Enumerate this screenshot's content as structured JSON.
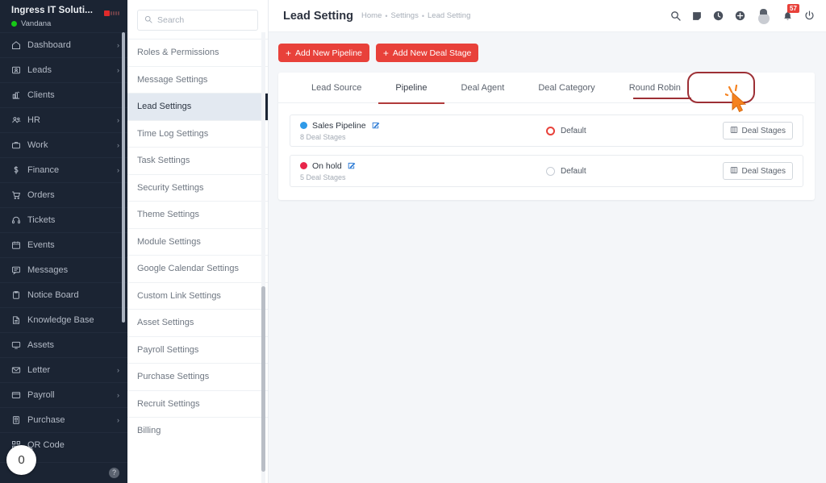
{
  "sidebar": {
    "company": "Ingress IT Soluti...",
    "user": "Vandana",
    "status_color": "#16c916",
    "items": [
      {
        "label": "Dashboard",
        "icon": "home-icon",
        "chevron": "›"
      },
      {
        "label": "Leads",
        "icon": "leads-icon",
        "chevron": "›"
      },
      {
        "label": "Clients",
        "icon": "clients-icon",
        "chevron": ""
      },
      {
        "label": "HR",
        "icon": "hr-icon",
        "chevron": "›"
      },
      {
        "label": "Work",
        "icon": "work-icon",
        "chevron": "›"
      },
      {
        "label": "Finance",
        "icon": "finance-icon",
        "chevron": "›"
      },
      {
        "label": "Orders",
        "icon": "orders-icon",
        "chevron": ""
      },
      {
        "label": "Tickets",
        "icon": "tickets-icon",
        "chevron": ""
      },
      {
        "label": "Events",
        "icon": "events-icon",
        "chevron": ""
      },
      {
        "label": "Messages",
        "icon": "messages-icon",
        "chevron": ""
      },
      {
        "label": "Notice Board",
        "icon": "notice-board-icon",
        "chevron": ""
      },
      {
        "label": "Knowledge Base",
        "icon": "knowledge-base-icon",
        "chevron": ""
      },
      {
        "label": "Assets",
        "icon": "assets-icon",
        "chevron": ""
      },
      {
        "label": "Letter",
        "icon": "letter-icon",
        "chevron": "›"
      },
      {
        "label": "Payroll",
        "icon": "payroll-icon",
        "chevron": "›"
      },
      {
        "label": "Purchase",
        "icon": "purchase-icon",
        "chevron": "›"
      },
      {
        "label": "QR Code",
        "icon": "qr-code-icon",
        "chevron": ""
      }
    ],
    "help_label": "?",
    "counter_bubble": "0"
  },
  "subnav": {
    "search_placeholder": "Search",
    "search_value": "",
    "items": [
      {
        "label": "Roles & Permissions",
        "active": false
      },
      {
        "label": "Message Settings",
        "active": false
      },
      {
        "label": "Lead Settings",
        "active": true
      },
      {
        "label": "Time Log Settings",
        "active": false
      },
      {
        "label": "Task Settings",
        "active": false
      },
      {
        "label": "Security Settings",
        "active": false
      },
      {
        "label": "Theme Settings",
        "active": false
      },
      {
        "label": "Module Settings",
        "active": false
      },
      {
        "label": "Google Calendar Settings",
        "active": false
      },
      {
        "label": "Custom Link Settings",
        "active": false
      },
      {
        "label": "Asset Settings",
        "active": false
      },
      {
        "label": "Payroll Settings",
        "active": false
      },
      {
        "label": "Purchase Settings",
        "active": false
      },
      {
        "label": "Recruit Settings",
        "active": false
      },
      {
        "label": "Billing",
        "active": false
      }
    ]
  },
  "header": {
    "title": "Lead Setting",
    "breadcrumb": [
      "Home",
      "Settings",
      "Lead Setting"
    ],
    "breadcrumb_sep": "•",
    "icons": [
      {
        "name": "search-icon"
      },
      {
        "name": "note-icon"
      },
      {
        "name": "clock-icon"
      },
      {
        "name": "plus-circle-icon"
      }
    ],
    "notification_count": "57",
    "power_label": "power-icon"
  },
  "toolbar": {
    "add_pipeline_label": "Add New Pipeline",
    "add_deal_stage_label": "Add New Deal Stage",
    "plus_glyph": "+",
    "accent_color": "#e8413a"
  },
  "tabs": [
    {
      "label": "Lead Source",
      "active": false
    },
    {
      "label": "Pipeline",
      "active": true
    },
    {
      "label": "Deal Agent",
      "active": false
    },
    {
      "label": "Deal Category",
      "active": false
    },
    {
      "label": "Round Robin",
      "active": false
    }
  ],
  "pipelines": [
    {
      "name": "Sales Pipeline",
      "color": "#2f9ae8",
      "stages_text": "8 Deal Stages",
      "default_label": "Default",
      "is_default": true,
      "action_label": "Deal Stages"
    },
    {
      "name": "On hold",
      "color": "#e8254a",
      "stages_text": "5 Deal Stages",
      "default_label": "Default",
      "is_default": false,
      "action_label": "Deal Stages"
    }
  ],
  "annotation": {
    "highlight_target": "Deal Agent",
    "highlight_color": "#9d2f35",
    "cursor_color": "#f58220"
  }
}
